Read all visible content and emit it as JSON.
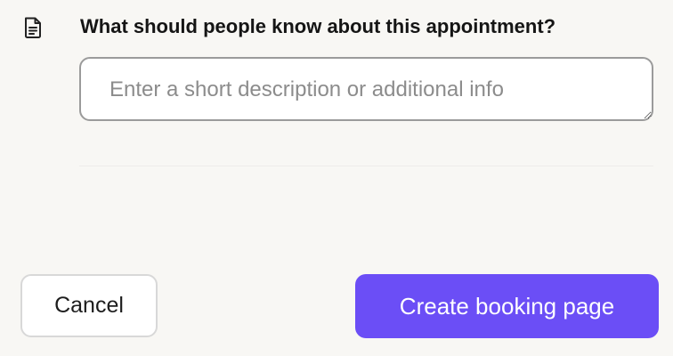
{
  "colors": {
    "background": "#f8f7f4",
    "primary_button": "#6b4ef6",
    "textarea_border": "#9b9b9b"
  },
  "description_section": {
    "icon": "document-text-icon",
    "question": "What should people know about this appointment?",
    "textarea": {
      "value": "",
      "placeholder": "Enter a short description or additional info"
    }
  },
  "footer": {
    "cancel_label": "Cancel",
    "create_label": "Create booking page"
  }
}
